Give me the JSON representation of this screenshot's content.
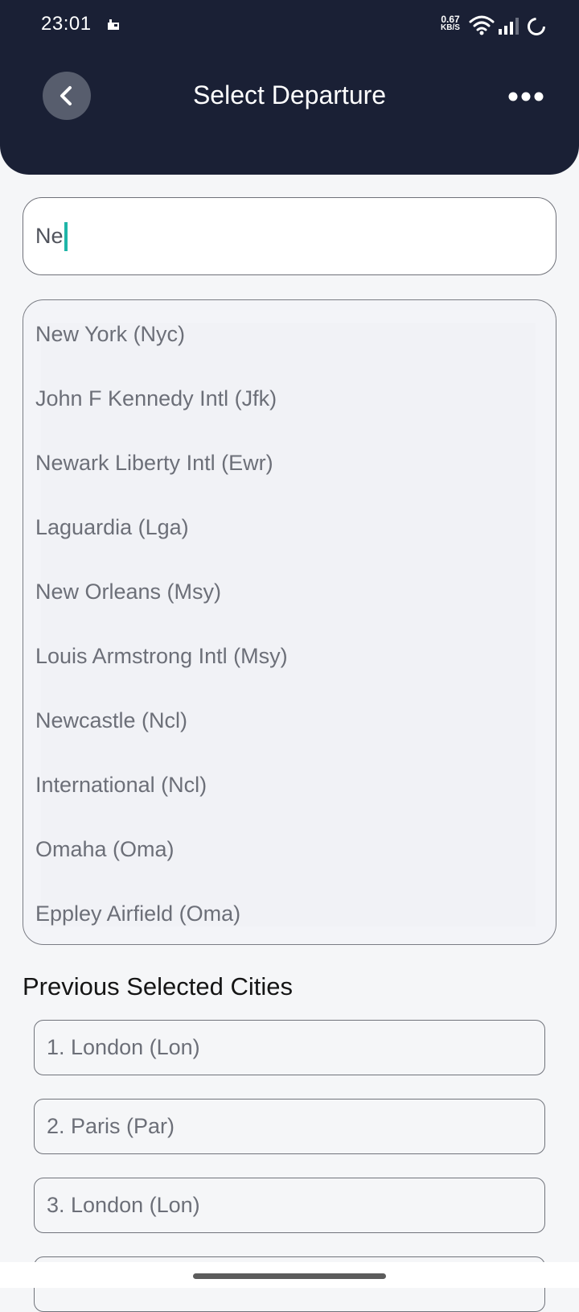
{
  "status_bar": {
    "time": "23:01",
    "net_speed_value": "0.67",
    "net_speed_unit": "KB/S",
    "icons": [
      "notification-icon",
      "wifi-icon",
      "signal-icon",
      "battery-loading-icon"
    ]
  },
  "header": {
    "title": "Select Departure",
    "back_icon": "chevron-left-icon",
    "more_icon": "more-horizontal-icon",
    "background_color": "#1a2035"
  },
  "search": {
    "value": "Ne",
    "cursor_color": "#1fb5a8"
  },
  "suggestions": [
    {
      "label": "New York (Nyc)"
    },
    {
      "label": "John F Kennedy Intl (Jfk)"
    },
    {
      "label": "Newark Liberty Intl (Ewr)"
    },
    {
      "label": "Laguardia (Lga)"
    },
    {
      "label": "New Orleans (Msy)"
    },
    {
      "label": "Louis Armstrong Intl (Msy)"
    },
    {
      "label": "Newcastle (Ncl)"
    },
    {
      "label": "International (Ncl)"
    },
    {
      "label": "Omaha (Oma)"
    },
    {
      "label": "Eppley Airfield (Oma)"
    }
  ],
  "previous": {
    "title": "Previous Selected Cities",
    "items": [
      {
        "label": "1. London  (Lon)"
      },
      {
        "label": "2. Paris  (Par)"
      },
      {
        "label": "3. London  (Lon)"
      }
    ]
  }
}
